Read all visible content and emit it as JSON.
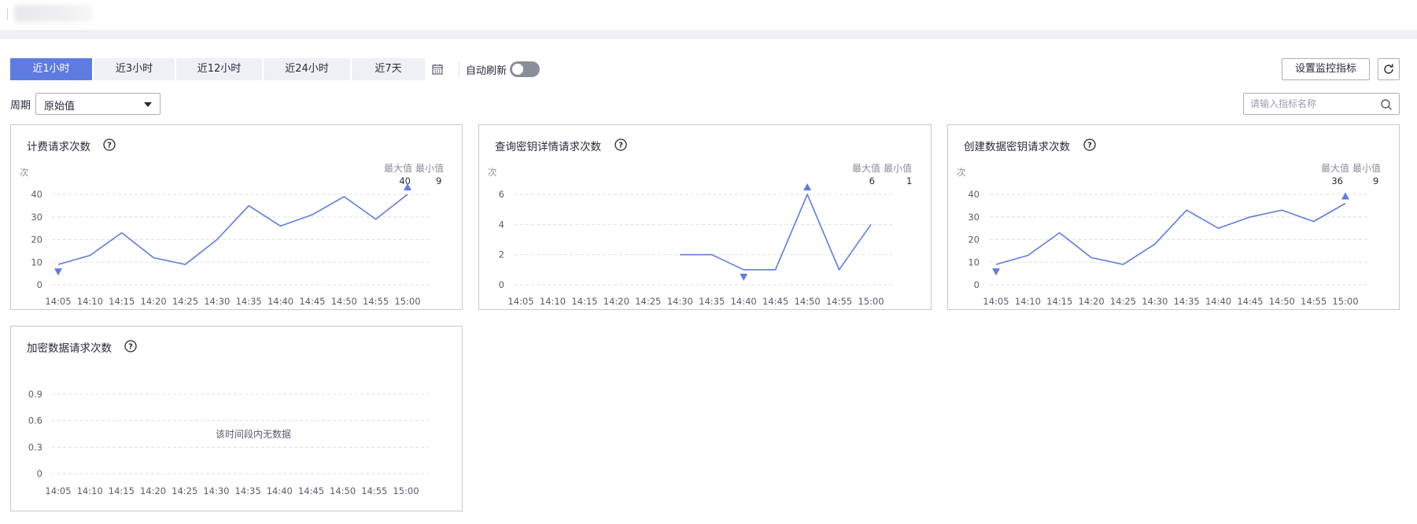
{
  "header": {
    "title": ""
  },
  "time_tabs": [
    {
      "label": "近1小时",
      "active": true
    },
    {
      "label": "近3小时",
      "active": false
    },
    {
      "label": "近12小时",
      "active": false
    },
    {
      "label": "近24小时",
      "active": false
    },
    {
      "label": "近7天",
      "active": false
    }
  ],
  "calendar_icon": "calendar-icon",
  "auto_refresh": {
    "label": "自动刷新",
    "enabled": false
  },
  "actions": {
    "set_metrics": "设置监控指标",
    "refresh_icon": "refresh-icon"
  },
  "period": {
    "label": "周期",
    "value": "原始值"
  },
  "search": {
    "placeholder": "请输入指标名称",
    "value": "",
    "icon": "search-icon"
  },
  "colors": {
    "accent": "#5e7ce0",
    "line": "#5e7ce0",
    "tab_bg": "#eef0f5",
    "grid": "#dfe1e6"
  },
  "labels": {
    "max": "最大值",
    "min": "最小值"
  },
  "charts": [
    {
      "title": "计费请求次数",
      "unit": "次",
      "max": "40",
      "min": "9",
      "no_data": ""
    },
    {
      "title": "查询密钥详情请求次数",
      "unit": "次",
      "max": "6",
      "min": "1",
      "no_data": ""
    },
    {
      "title": "创建数据密钥请求次数",
      "unit": "次",
      "max": "36",
      "min": "9",
      "no_data": ""
    },
    {
      "title": "加密数据请求次数",
      "unit": "",
      "max": "",
      "min": "",
      "no_data": "该时间段内无数据"
    }
  ],
  "chart_data": [
    {
      "type": "line",
      "title": "计费请求次数",
      "ylabel": "次",
      "x": [
        "14:05",
        "14:10",
        "14:15",
        "14:20",
        "14:25",
        "14:30",
        "14:35",
        "14:40",
        "14:45",
        "14:50",
        "14:55",
        "15:00"
      ],
      "yticks": [
        "0",
        "10",
        "20",
        "30",
        "40"
      ],
      "ylim": [
        0,
        40
      ],
      "series": [
        {
          "values": [
            9,
            13,
            23,
            12,
            9,
            20,
            35,
            26,
            31,
            39,
            29,
            40
          ]
        }
      ],
      "max": 40,
      "min": 9
    },
    {
      "type": "line",
      "title": "查询密钥详情请求次数",
      "ylabel": "次",
      "x": [
        "14:05",
        "14:10",
        "14:15",
        "14:20",
        "14:25",
        "14:30",
        "14:35",
        "14:40",
        "14:45",
        "14:50",
        "14:55",
        "15:00"
      ],
      "yticks": [
        "0",
        "2",
        "4",
        "6"
      ],
      "ylim": [
        0,
        6
      ],
      "series": [
        {
          "values": [
            null,
            null,
            null,
            null,
            null,
            2,
            2,
            1,
            1,
            6,
            1,
            4
          ]
        }
      ],
      "max": 6,
      "min": 1
    },
    {
      "type": "line",
      "title": "创建数据密钥请求次数",
      "ylabel": "次",
      "x": [
        "14:05",
        "14:10",
        "14:15",
        "14:20",
        "14:25",
        "14:30",
        "14:35",
        "14:40",
        "14:45",
        "14:50",
        "14:55",
        "15:00"
      ],
      "yticks": [
        "0",
        "10",
        "20",
        "30",
        "40"
      ],
      "ylim": [
        0,
        40
      ],
      "series": [
        {
          "values": [
            9,
            13,
            23,
            12,
            9,
            18,
            33,
            25,
            30,
            33,
            28,
            36
          ]
        }
      ],
      "max": 36,
      "min": 9
    },
    {
      "type": "line",
      "title": "加密数据请求次数",
      "ylabel": "",
      "x": [
        "14:05",
        "14:10",
        "14:15",
        "14:20",
        "14:25",
        "14:30",
        "14:35",
        "14:40",
        "14:45",
        "14:50",
        "14:55",
        "15:00"
      ],
      "yticks": [
        "0",
        "0.3",
        "0.6",
        "0.9"
      ],
      "ylim": [
        0,
        0.9
      ],
      "series": [],
      "no_data": "该时间段内无数据"
    }
  ]
}
